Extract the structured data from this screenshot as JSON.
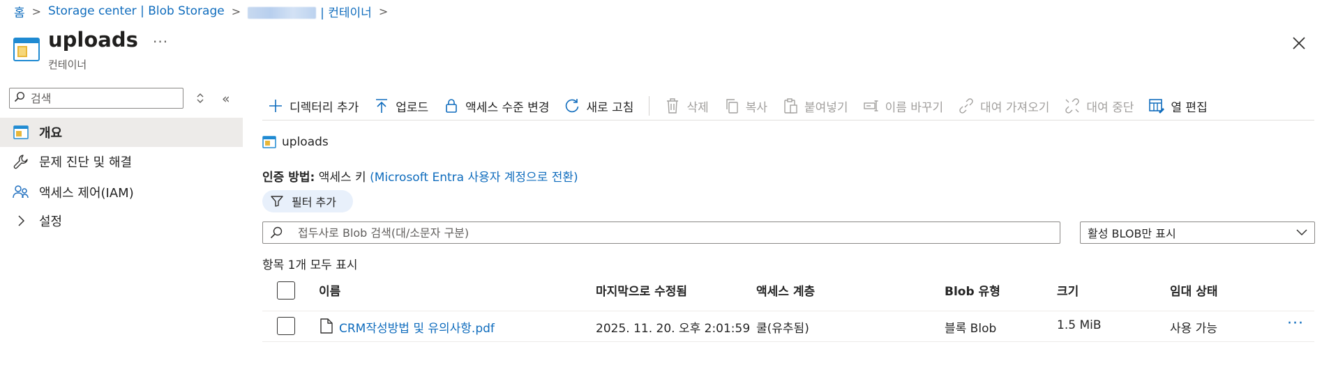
{
  "breadcrumb": {
    "home": "홈",
    "storage": "Storage center | Blob Storage",
    "account_suffix": "| 컨테이너"
  },
  "header": {
    "title": "uploads",
    "subtitle": "컨테이너",
    "more": "···"
  },
  "sidebar": {
    "search_placeholder": "검색",
    "collapse": "«",
    "items": [
      {
        "label": "개요",
        "icon": "container-icon",
        "active": true
      },
      {
        "label": "문제 진단 및 해결",
        "icon": "wrench-icon"
      },
      {
        "label": "액세스 제어(IAM)",
        "icon": "people-icon"
      },
      {
        "label": "설정",
        "icon": "chevron-right-icon"
      }
    ]
  },
  "toolbar": {
    "add_directory": "디렉터리 추가",
    "upload": "업로드",
    "change_access_level": "액세스 수준 변경",
    "refresh": "새로 고침",
    "delete": "삭제",
    "copy": "복사",
    "paste": "붙여넣기",
    "rename": "이름 바꾸기",
    "acquire_lease": "대여 가져오기",
    "break_lease": "대여 중단",
    "edit_columns": "열 편집"
  },
  "content": {
    "path": "uploads",
    "auth_label": "인증 방법:",
    "auth_value": "액세스 키",
    "auth_switch_link": "(Microsoft Entra 사용자 계정으로 전환)",
    "filter_button": "필터 추가",
    "search_placeholder": "접두사로 Blob 검색(대/소문자 구분)",
    "dropdown_value": "활성 BLOB만 표시",
    "count_text": "항목 1개 모두 표시"
  },
  "table": {
    "headers": {
      "name": "이름",
      "modified": "마지막으로 수정됨",
      "tier": "액세스 계층",
      "blob_type": "Blob 유형",
      "size": "크기",
      "lease": "임대 상태"
    },
    "rows": [
      {
        "name": "CRM작성방법 및 유의사항.pdf",
        "modified": "2025. 11. 20. 오후 2:01:59",
        "tier": "쿨(유추됨)",
        "blob_type": "블록 Blob",
        "size": "1.5 MiB",
        "lease": "사용 가능",
        "more": "···"
      }
    ]
  },
  "colors": {
    "accent": "#0f6cbd",
    "nav_active_bg": "#edebe9",
    "filter_pill_bg": "#e8f0fb",
    "disabled_text": "#a19f9d"
  }
}
